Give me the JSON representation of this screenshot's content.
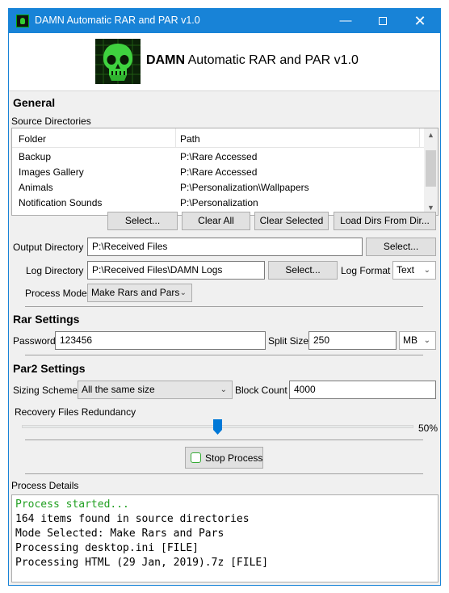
{
  "window": {
    "title": "DAMN Automatic RAR and PAR v1.0",
    "accent": "#1883d7"
  },
  "header": {
    "title_bold": "DAMN",
    "title_rest": " Automatic RAR and PAR v1.0"
  },
  "general": {
    "title": "General",
    "source_label": "Source Directories",
    "columns": [
      "Folder",
      "Path"
    ],
    "rows": [
      {
        "folder": "Backup",
        "path": "P:\\Rare Accessed"
      },
      {
        "folder": "Images Gallery",
        "path": "P:\\Rare Accessed"
      },
      {
        "folder": "Animals",
        "path": "P:\\Personalization\\Wallpapers"
      },
      {
        "folder": "Notification Sounds",
        "path": "P:\\Personalization"
      }
    ],
    "buttons": {
      "select": "Select...",
      "clear_all": "Clear All",
      "clear_selected": "Clear Selected",
      "load_dirs": "Load Dirs From Dir..."
    },
    "output_label": "Output Directory",
    "output_value": "P:\\Received Files",
    "output_select": "Select...",
    "log_label": "Log Directory",
    "log_value": "P:\\Received Files\\DAMN Logs",
    "log_select": "Select...",
    "log_format_label": "Log Format",
    "log_format_value": "Text",
    "process_mode_label": "Process Mode",
    "process_mode_value": "Make Rars and Pars"
  },
  "rar": {
    "title": "Rar Settings",
    "password_label": "Password",
    "password_value": "123456",
    "split_label": "Split Size",
    "split_value": "250",
    "split_unit": "MB"
  },
  "par2": {
    "title": "Par2 Settings",
    "sizing_label": "Sizing Scheme",
    "sizing_value": "All the same size",
    "block_label": "Block Count",
    "block_value": "4000",
    "redundancy_label": "Recovery Files Redundancy",
    "redundancy_value": 50,
    "redundancy_text": "50%"
  },
  "stop_button": "Stop Process",
  "details": {
    "label": "Process Details",
    "lines": [
      {
        "text": "Process started...",
        "color": "#22a022"
      },
      {
        "text": "164 items found in source directories",
        "color": "#000000"
      },
      {
        "text": "Mode Selected: Make Rars and Pars",
        "color": "#000000"
      },
      {
        "text": "Processing desktop.ini [FILE]",
        "color": "#000000"
      },
      {
        "text": "Processing HTML (29 Jan, 2019).7z [FILE]",
        "color": "#000000"
      }
    ]
  }
}
